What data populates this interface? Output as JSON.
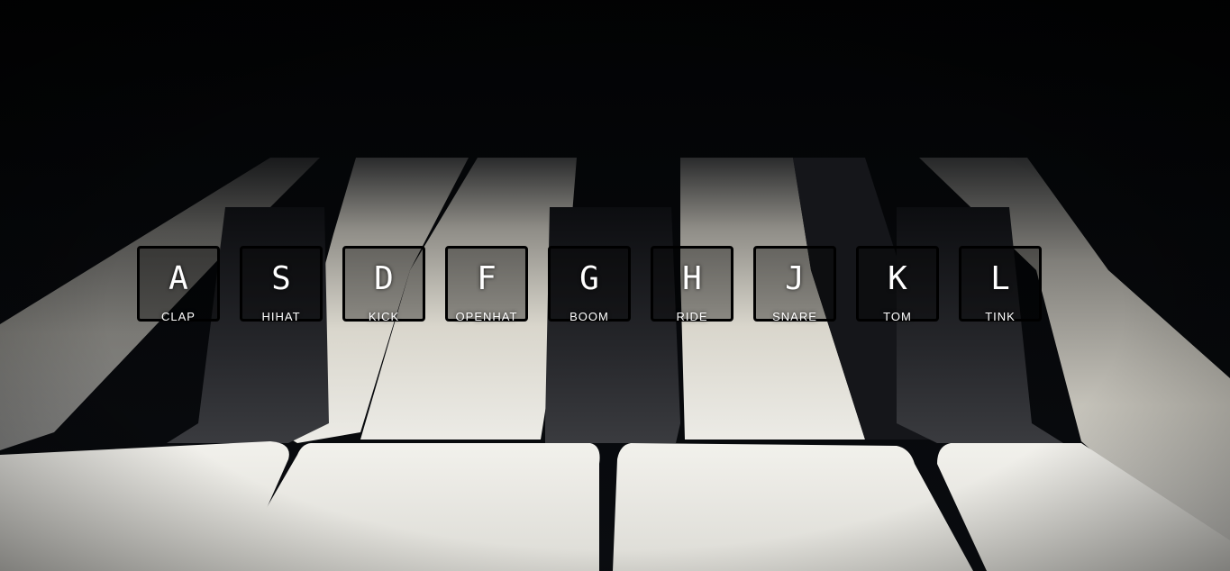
{
  "keys": [
    {
      "letter": "A",
      "sound": "CLAP"
    },
    {
      "letter": "S",
      "sound": "HIHAT"
    },
    {
      "letter": "D",
      "sound": "KICK"
    },
    {
      "letter": "F",
      "sound": "OPENHAT"
    },
    {
      "letter": "G",
      "sound": "BOOM"
    },
    {
      "letter": "H",
      "sound": "RIDE"
    },
    {
      "letter": "J",
      "sound": "SNARE"
    },
    {
      "letter": "K",
      "sound": "TOM"
    },
    {
      "letter": "L",
      "sound": "TINK"
    }
  ],
  "colors": {
    "background": "#000000",
    "white_key": "#e6e4dc",
    "black_key": "#1c1d20",
    "key_border": "#000000",
    "label_text": "#ffffff"
  }
}
